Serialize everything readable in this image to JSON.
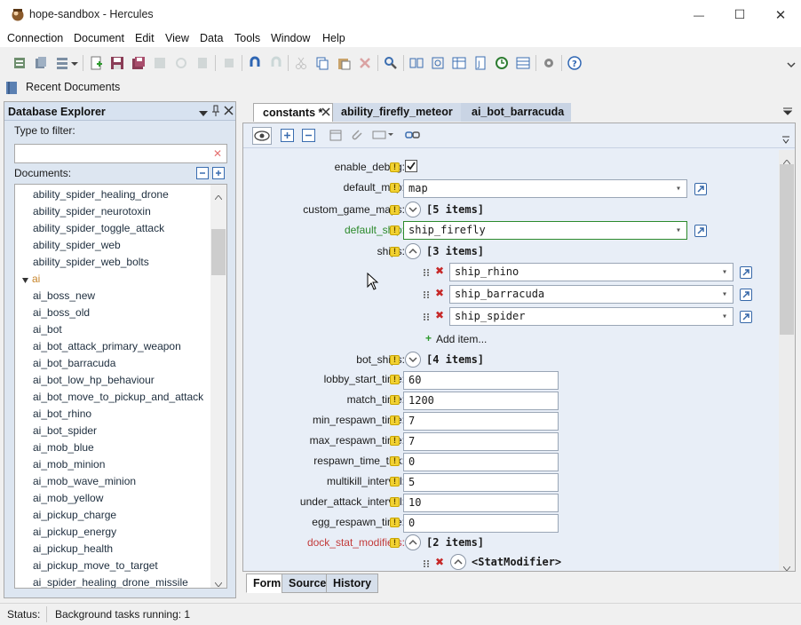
{
  "window": {
    "title": "hope-sandbox - Hercules",
    "minimize": "—",
    "maximize": "☐",
    "close": "✕"
  },
  "menu": [
    "Connection",
    "Document",
    "Edit",
    "View",
    "Data",
    "Tools",
    "Window",
    "Help"
  ],
  "recent_documents": "Recent Documents",
  "explorer": {
    "title": "Database Explorer",
    "filter_label": "Type to filter:",
    "filter_value": "",
    "documents_label": "Documents:",
    "items": [
      "ability_spider_healing_drone",
      "ability_spider_neurotoxin",
      "ability_spider_toggle_attack",
      "ability_spider_web",
      "ability_spider_web_bolts",
      "ai",
      "ai_boss_new",
      "ai_boss_old",
      "ai_bot",
      "ai_bot_attack_primary_weapon",
      "ai_bot_barracuda",
      "ai_bot_low_hp_behaviour",
      "ai_bot_move_to_pickup_and_attack",
      "ai_bot_rhino",
      "ai_bot_spider",
      "ai_mob_blue",
      "ai_mob_minion",
      "ai_mob_wave_minion",
      "ai_mob_yellow",
      "ai_pickup_charge",
      "ai_pickup_energy",
      "ai_pickup_health",
      "ai_pickup_move_to_target",
      "ai_spider_healing_drone_missile"
    ]
  },
  "tabs": [
    "constants *",
    "ability_firefly_meteor",
    "ai_bot_barracuda"
  ],
  "form": {
    "enable_debug": {
      "label": "enable_debug:",
      "checked": true
    },
    "default_map": {
      "label": "default_map:",
      "value": "map"
    },
    "custom_game_maps": {
      "label": "custom_game_maps:",
      "value": "[5 items]"
    },
    "default_ship": {
      "label": "default_ship:",
      "value": "ship_firefly"
    },
    "ships": {
      "label": "ships:",
      "value": "[3 items]",
      "items": [
        "ship_rhino",
        "ship_barracuda",
        "ship_spider"
      ],
      "add": "Add item..."
    },
    "bot_ships": {
      "label": "bot_ships:",
      "value": "[4 items]"
    },
    "fields": [
      {
        "label": "lobby_start_time:",
        "value": "60"
      },
      {
        "label": "match_time:",
        "value": "1200"
      },
      {
        "label": "min_respawn_time:",
        "value": "7"
      },
      {
        "label": "max_respawn_time:",
        "value": "7"
      },
      {
        "label": "respawn_time_tick:",
        "value": "0"
      },
      {
        "label": "multikill_interval:",
        "value": "5"
      },
      {
        "label": "under_attack_interval:",
        "value": "10"
      },
      {
        "label": "egg_respawn_time:",
        "value": "0"
      }
    ],
    "dock_stat_modifiers": {
      "label": "dock_stat_modifiers:",
      "value": "[2 items]",
      "child": "<StatModifier>"
    }
  },
  "bottom_tabs": [
    "Form",
    "Source",
    "History"
  ],
  "status": {
    "label": "Status:",
    "text": "Background tasks running: 1"
  }
}
